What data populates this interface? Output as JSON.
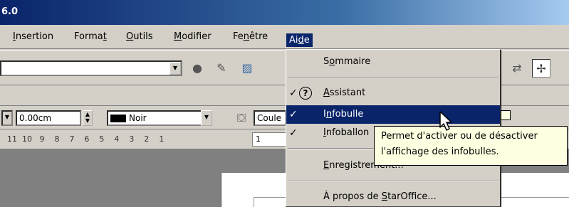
{
  "window": {
    "title": "6.0"
  },
  "menubar": {
    "items": [
      {
        "pre": "",
        "mn": "I",
        "post": "nsertion"
      },
      {
        "pre": "Forma",
        "mn": "t",
        "post": ""
      },
      {
        "pre": "",
        "mn": "O",
        "post": "utils"
      },
      {
        "pre": "",
        "mn": "M",
        "post": "odifier"
      },
      {
        "pre": "Fe",
        "mn": "n",
        "post": "être"
      },
      {
        "pre": "Ai",
        "mn": "d",
        "post": "e"
      }
    ]
  },
  "toolbar3": {
    "line_width": "0.00cm",
    "line_color": "Noir",
    "area_color": "Coule"
  },
  "ruler": {
    "numbers": "11  10   9    8    7    6    5    4    3    2    1",
    "value": "1"
  },
  "aide_menu": {
    "items": [
      {
        "pre": "S",
        "mn": "o",
        "post": "mmaire",
        "checked": false
      },
      {
        "pre": "",
        "mn": "A",
        "post": "ssistant",
        "checked": true
      },
      {
        "pre": "I",
        "mn": "n",
        "post": "fobulle",
        "checked": true
      },
      {
        "pre": "",
        "mn": "I",
        "post": "nfoballon",
        "checked": true
      },
      {
        "pre": "",
        "mn": "E",
        "post": "nregistrement...",
        "checked": false
      },
      {
        "pre": "À propos de ",
        "mn": "S",
        "post": "tarOffice...",
        "checked": false
      }
    ]
  },
  "tooltip": {
    "line1": "Permet d'activer ou de désactiver",
    "line2": "l'affichage des infobulles."
  },
  "colors": {
    "title_bar": "#0a246a",
    "highlight": "#0a246a",
    "tooltip_bg": "#ffffe1",
    "face": "#d4d0c8"
  }
}
